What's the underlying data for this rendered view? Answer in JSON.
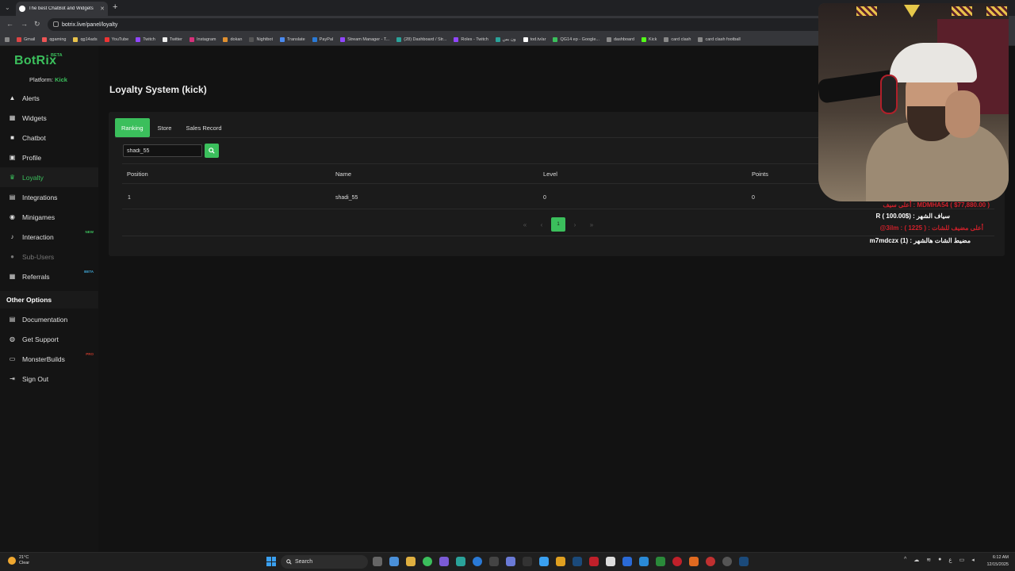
{
  "browser": {
    "tab_title": "The best ChatBot and Widgets",
    "url": "botrix.live/panel/loyalty",
    "bookmarks": [
      "Gmail",
      "qgaming",
      "qg14ads",
      "YouTube",
      "Twitch",
      "Twitter",
      "Instagram",
      "dokan",
      "Nightbot",
      "Translate",
      "PayPal",
      "Stream Manager - T...",
      "(28) Dashboard / Str...",
      "Roles - Twitch",
      "ون بس",
      "tod.tv/ar",
      "QG14 ep - Google...",
      "dashboard",
      "Kick",
      "card clash",
      "card clash football"
    ]
  },
  "sidebar": {
    "logo": "BotRix",
    "logo_badge": "BETA",
    "platform_label": "Platform:",
    "platform_value": "Kick",
    "items": [
      {
        "label": "Alerts",
        "icon": "warning-icon"
      },
      {
        "label": "Widgets",
        "icon": "widgets-icon"
      },
      {
        "label": "Chatbot",
        "icon": "chatbot-icon"
      },
      {
        "label": "Profile",
        "icon": "profile-icon"
      },
      {
        "label": "Loyalty",
        "icon": "trophy-icon",
        "active": true
      },
      {
        "label": "Integrations",
        "icon": "integrations-icon"
      },
      {
        "label": "Minigames",
        "icon": "gamepad-icon"
      },
      {
        "label": "Interaction",
        "icon": "music-icon",
        "badge": "NEW"
      },
      {
        "label": "Sub-Users",
        "icon": "users-icon",
        "disabled": true
      },
      {
        "label": "Referrals",
        "icon": "referrals-icon",
        "badge": "BETA"
      }
    ],
    "other_title": "Other Options",
    "other_items": [
      {
        "label": "Documentation",
        "icon": "docs-icon"
      },
      {
        "label": "Get Support",
        "icon": "support-icon"
      },
      {
        "label": "MonsterBuilds",
        "icon": "monitor-icon",
        "badge": "PRO"
      },
      {
        "label": "Sign Out",
        "icon": "signout-icon"
      }
    ]
  },
  "main": {
    "title": "Loyalty System (kick)",
    "tabs": [
      "Ranking",
      "Store",
      "Sales Record"
    ],
    "search_value": "shadi_55",
    "columns": [
      "Position",
      "Name",
      "Level",
      "Points"
    ],
    "rows": [
      {
        "position": "1",
        "name": "shadi_55",
        "level": "0",
        "points": "0"
      }
    ],
    "current_page": "1"
  },
  "overlay": {
    "line1": "MDMHA54 ( $77,880.00 ) : أعلى سيف",
    "line2": "سياف الشهر : ($100.00 ) R",
    "line3": "أعلى مضيف للشات : ( 1225 ) : 3ilm@",
    "line4": "مضيط الشات هالشهر : (1) m7mdczx"
  },
  "taskbar": {
    "temp": "21°C",
    "weather": "Clear",
    "search_label": "Search",
    "time": "6:12 AM",
    "date": "12/15/2025"
  },
  "colors": {
    "accent": "#3bbf5c",
    "background": "#121212",
    "card": "#1b1b1b"
  }
}
